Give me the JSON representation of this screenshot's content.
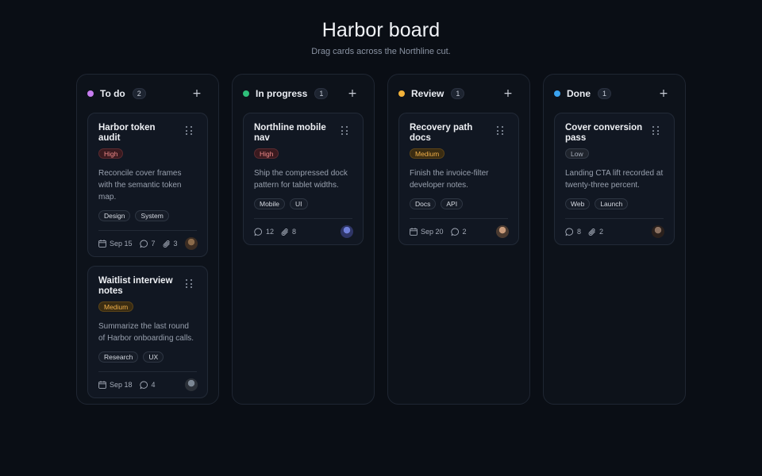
{
  "header": {
    "title": "Harbor board",
    "subtitle": "Drag cards across the Northline cut."
  },
  "columns": [
    {
      "name": "To do",
      "count": "2",
      "color": "#c77df0",
      "cards": [
        {
          "title": "Harbor token audit",
          "priority": "High",
          "priority_level": "high",
          "description": "Reconcile cover frames with the semantic token map.",
          "tags": [
            "Design",
            "System"
          ],
          "date": "Sep 15",
          "comments": "7",
          "attachments": "3",
          "avatar_colors": [
            "#8a6a4a",
            "#3b2c22"
          ]
        },
        {
          "title": "Waitlist interview notes",
          "priority": "Medium",
          "priority_level": "medium",
          "description": "Summarize the last round of Harbor onboarding calls.",
          "tags": [
            "Research",
            "UX"
          ],
          "date": "Sep 18",
          "comments": "4",
          "attachments": "",
          "avatar_colors": [
            "#7c8794",
            "#2b3038"
          ]
        }
      ]
    },
    {
      "name": "In progress",
      "count": "1",
      "color": "#2fbf7a",
      "cards": [
        {
          "title": "Northline mobile nav",
          "priority": "High",
          "priority_level": "high",
          "description": "Ship the compressed dock pattern for tablet widths.",
          "tags": [
            "Mobile",
            "UI"
          ],
          "date": "",
          "comments": "12",
          "attachments": "8",
          "avatar_colors": [
            "#6f7fd8",
            "#2e3566"
          ]
        }
      ]
    },
    {
      "name": "Review",
      "count": "1",
      "color": "#f2b23a",
      "cards": [
        {
          "title": "Recovery path docs",
          "priority": "Medium",
          "priority_level": "medium",
          "description": "Finish the invoice-filter developer notes.",
          "tags": [
            "Docs",
            "API"
          ],
          "date": "Sep 20",
          "comments": "2",
          "attachments": "",
          "avatar_colors": [
            "#c89a7a",
            "#4a3a30"
          ]
        }
      ]
    },
    {
      "name": "Done",
      "count": "1",
      "color": "#3aa3f0",
      "cards": [
        {
          "title": "Cover conversion pass",
          "priority": "Low",
          "priority_level": "low",
          "description": "Landing CTA lift recorded at twenty-three percent.",
          "tags": [
            "Web",
            "Launch"
          ],
          "date": "",
          "comments": "8",
          "attachments": "2",
          "avatar_colors": [
            "#8a7060",
            "#2a201c"
          ]
        }
      ]
    }
  ],
  "icons": {
    "add": "plus-icon",
    "drag": "drag-handle-icon",
    "date": "calendar-icon",
    "comments": "comment-icon",
    "attachments": "paperclip-icon"
  }
}
